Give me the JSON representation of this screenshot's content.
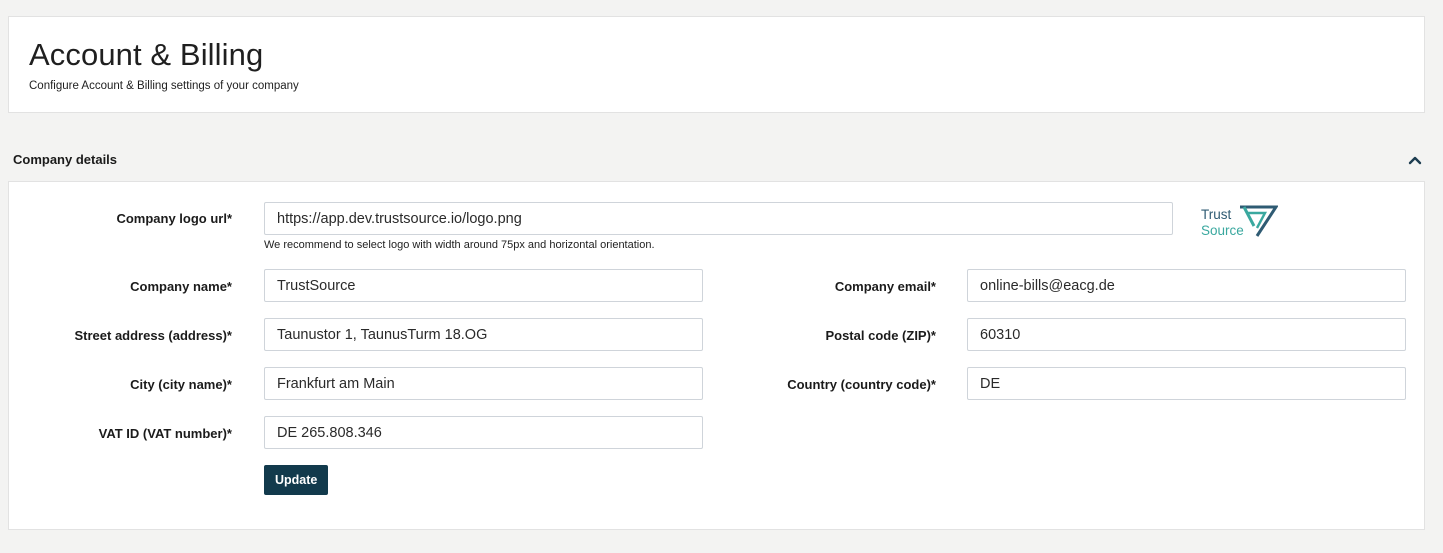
{
  "header": {
    "title": "Account & Billing",
    "subtitle": "Configure Account & Billing settings of your company"
  },
  "section": {
    "title": "Company details",
    "collapse_icon": "chevron-up-icon"
  },
  "form": {
    "logo_url": {
      "label": "Company logo url*",
      "value": "https://app.dev.trustsource.io/logo.png",
      "hint": "We recommend to select logo with width around 75px and horizontal orientation."
    },
    "logo_preview": {
      "line1": "Trust",
      "line2": "Source",
      "mark_icon": "triangle-logo-mark"
    },
    "company_name": {
      "label": "Company name*",
      "value": "TrustSource"
    },
    "company_email": {
      "label": "Company email*",
      "value": "online-bills@eacg.de"
    },
    "street_address": {
      "label": "Street address (address)*",
      "value": "Taunustor 1, TaunusTurm 18.OG"
    },
    "postal_code": {
      "label": "Postal code (ZIP)*",
      "value": "60310"
    },
    "city": {
      "label": "City (city name)*",
      "value": "Frankfurt am Main"
    },
    "country": {
      "label": "Country (country code)*",
      "value": "DE"
    },
    "vat_id": {
      "label": "VAT ID (VAT number)*",
      "value": "DE 265.808.346"
    },
    "update_label": "Update"
  },
  "colors": {
    "page_bg": "#f3f3f2",
    "button_bg": "#123a4c",
    "logo_dark": "#2f5b73",
    "logo_teal": "#3aa89f"
  }
}
